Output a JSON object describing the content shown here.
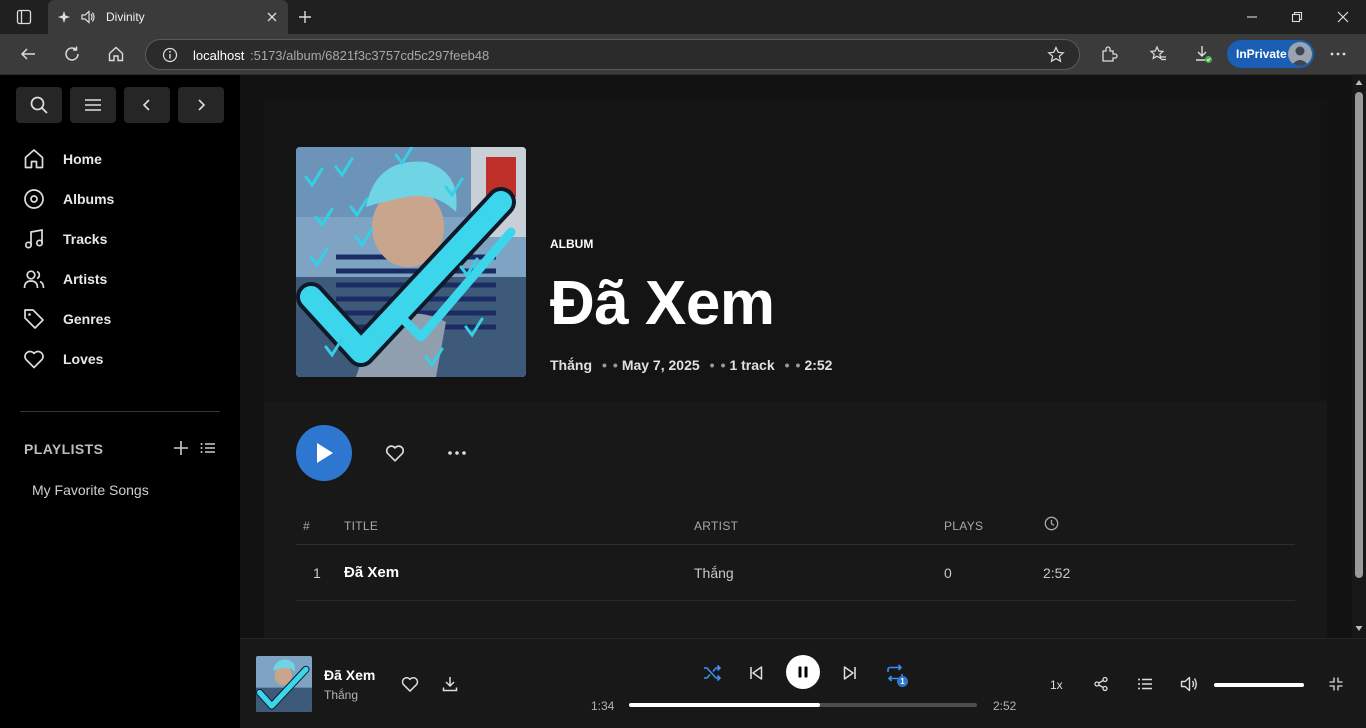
{
  "browser": {
    "tab_title": "Divinity",
    "url_host": "localhost",
    "url_rest": ":5173/album/6821f3c3757cd5c297feeb48",
    "inprivate_label": "InPrivate"
  },
  "sidebar": {
    "nav": [
      {
        "label": "Home",
        "icon": "home-icon"
      },
      {
        "label": "Albums",
        "icon": "disc-icon"
      },
      {
        "label": "Tracks",
        "icon": "music-note-icon"
      },
      {
        "label": "Artists",
        "icon": "users-icon"
      },
      {
        "label": "Genres",
        "icon": "tag-icon"
      },
      {
        "label": "Loves",
        "icon": "heart-icon"
      }
    ],
    "playlists_heading": "PLAYLISTS",
    "playlists": [
      "My Favorite Songs"
    ]
  },
  "album": {
    "type_label": "ALBUM",
    "title": "Đã Xem",
    "artist": "Thắng",
    "date": "May 7, 2025",
    "track_count": "1 track",
    "duration": "2:52"
  },
  "table": {
    "headers": {
      "num": "#",
      "title": "TITLE",
      "artist": "ARTIST",
      "plays": "PLAYS"
    },
    "rows": [
      {
        "num": "1",
        "title": "Đã Xem",
        "artist": "Thắng",
        "plays": "0",
        "duration": "2:52"
      }
    ]
  },
  "player": {
    "title": "Đã Xem",
    "artist": "Thắng",
    "elapsed": "1:34",
    "total": "2:52",
    "progress": 0.55,
    "volume": 1.0,
    "speed": "1x",
    "repeat_badge": "1"
  },
  "colors": {
    "accent": "#2e77d0",
    "shuffle": "#3d8ff0",
    "background": "#121212"
  }
}
